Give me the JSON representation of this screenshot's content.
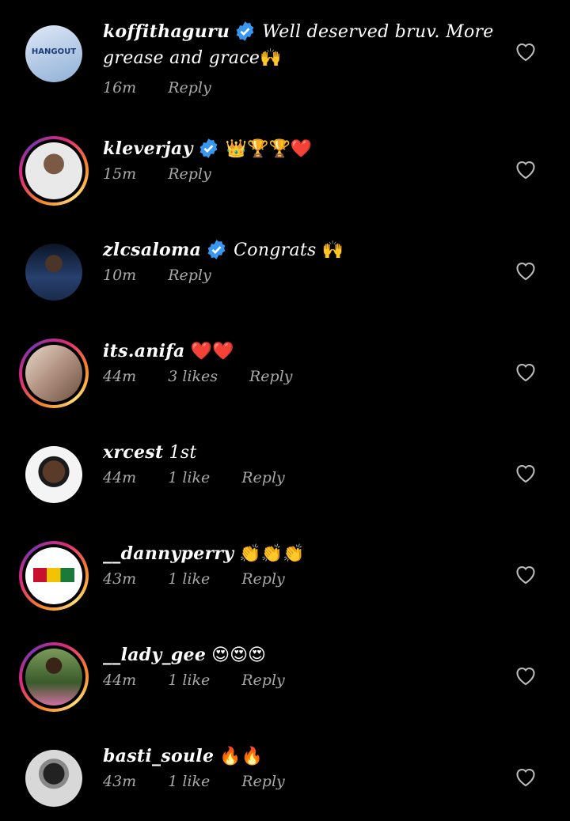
{
  "comments": [
    {
      "username": "koffithaguru",
      "verified": true,
      "text": "Well deserved bruv.  More grease and grace",
      "emoji": "🙌",
      "time": "16m",
      "likes": "",
      "reply": "Reply",
      "ring": false,
      "avatar_text": "HANGOUT"
    },
    {
      "username": "kleverjay",
      "verified": true,
      "text": "",
      "emoji": "👑🏆🏆❤️",
      "time": "15m",
      "likes": "",
      "reply": "Reply",
      "ring": true,
      "avatar_text": ""
    },
    {
      "username": "zlcsaloma",
      "verified": true,
      "text": "Congrats",
      "emoji": "🙌",
      "time": "10m",
      "likes": "",
      "reply": "Reply",
      "ring": false,
      "avatar_text": ""
    },
    {
      "username": "its.anifa",
      "verified": false,
      "text": "",
      "emoji": "❤️❤️",
      "time": "44m",
      "likes": "3 likes",
      "reply": "Reply",
      "ring": true,
      "avatar_text": ""
    },
    {
      "username": "xrcest",
      "verified": false,
      "text": "1st",
      "emoji": "",
      "time": "44m",
      "likes": "1 like",
      "reply": "Reply",
      "ring": false,
      "avatar_text": ""
    },
    {
      "username": "__dannyperry",
      "verified": false,
      "text": "",
      "emoji": "👏👏👏",
      "time": "43m",
      "likes": "1 like",
      "reply": "Reply",
      "ring": true,
      "avatar_text": ""
    },
    {
      "username": "__lady_gee",
      "verified": false,
      "text": "",
      "emoji": "😍😍😍",
      "time": "44m",
      "likes": "1 like",
      "reply": "Reply",
      "ring": true,
      "avatar_text": ""
    },
    {
      "username": "basti_soule",
      "verified": false,
      "text": "",
      "emoji": "🔥🔥",
      "time": "43m",
      "likes": "1 like",
      "reply": "Reply",
      "ring": false,
      "avatar_text": ""
    }
  ],
  "colors": {
    "background": "#000000",
    "verified": "#3897f0",
    "meta": "#a8a8a8"
  }
}
